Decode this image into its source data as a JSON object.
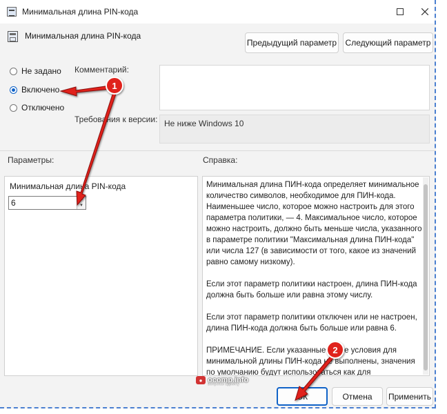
{
  "window": {
    "title": "Минимальная длина PIN-кода"
  },
  "header": {
    "policy_title": "Минимальная длина PIN-кода",
    "prev_button": "Предыдущий параметр",
    "next_button": "Следующий параметр"
  },
  "state": {
    "options": [
      {
        "label": "Не задано",
        "checked": false
      },
      {
        "label": "Включено",
        "checked": true
      },
      {
        "label": "Отключено",
        "checked": false
      }
    ]
  },
  "comment": {
    "label": "Комментарий:",
    "value": ""
  },
  "requirements": {
    "label": "Требования к версии:",
    "value": "Не ниже Windows 10"
  },
  "params": {
    "label": "Параметры:",
    "field_label": "Минимальная длина PIN-кода",
    "field_value": "6"
  },
  "help": {
    "label": "Справка:",
    "paragraphs": [
      "Минимальная длина ПИН-кода определяет минимальное количество символов, необходимое для ПИН-кода. Наименьшее число, которое можно настроить для этого параметра политики, — 4.  Максимальное число, которое можно настроить, должно быть меньше числа, указанного в параметре политики \"Максимальная длина ПИН-кода\" или числа 127 (в зависимости от того, какое из значений равно самому низкому).",
      "Если этот параметр политики настроен, длина ПИН-кода должна быть больше или равна этому числу.",
      "Если этот параметр политики отключен или не настроен, длина ПИН-кода должна быть больше или равна 6.",
      "ПРИМЕЧАНИЕ. Если указанные выше условия для минимальной длины ПИН-кода не выполнены, значения по умолчанию будут использоваться как для максимальной, так и для минимальной длины ПИН-кода."
    ]
  },
  "footer": {
    "ok": "ОК",
    "cancel": "Отмена",
    "apply": "Применить"
  },
  "watermark": {
    "text": "ocomp.info",
    "sub": "вопросы админу"
  },
  "callouts": {
    "badge1": "1",
    "badge2": "2",
    "color": "#e0201a"
  }
}
